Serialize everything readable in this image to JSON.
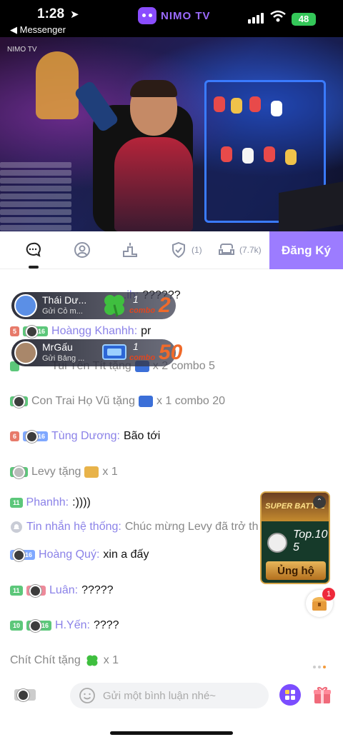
{
  "status": {
    "time": "1:28",
    "back": "◀ Messenger",
    "battery": "48"
  },
  "brand": {
    "name": "NIMO TV"
  },
  "video": {
    "watermark": "NIMO TV"
  },
  "tabs": {
    "fans_count": "(1)",
    "viewers_count": "(7.7k)",
    "subscribe": "Đăng Ký"
  },
  "banners": [
    {
      "name": "Thái Dư...",
      "sub": "Gửi Cỏ m...",
      "one": "1",
      "combo": "combo",
      "count": "2"
    },
    {
      "name": "MrGấu",
      "sub": "Gửi Bảng ...",
      "one": "1",
      "combo": "combo",
      "count": "50"
    }
  ],
  "messages": {
    "m0": {
      "name": "...ih:",
      "text": "??????"
    },
    "m1": {
      "level": "5",
      "fan": "16",
      "name": "Hoàngg Khanhh:",
      "text": "pr"
    },
    "m2": {
      "name": "Tui Tên Tít tặng",
      "text": "x 2 combo 5"
    },
    "m3": {
      "name": "Con Trai Họ Vũ tặng",
      "text": "x 1 combo 20"
    },
    "m4": {
      "level": "6",
      "fan": "16",
      "name": "Tùng Dương:",
      "text": "Bão tới"
    },
    "m5": {
      "name": "Levy tặng",
      "text": "x 1"
    },
    "m6": {
      "level": "11",
      "name": "Phanhh:",
      "text": ":))))"
    },
    "m7": {
      "label": "Tin nhắn hệ thống:",
      "text": "Chúc mừng Levy đã trở th"
    },
    "m8": {
      "fan": "16",
      "name": "Hoàng Quý:",
      "text": "xin a đấy"
    },
    "m9": {
      "level": "11",
      "name": "Luân:",
      "text": "?????"
    },
    "m10": {
      "level": "10",
      "fan": "16",
      "name": "H.Yến:",
      "text": "????"
    },
    "m11": {
      "name": "Chít Chít tặng",
      "text": "x 1"
    }
  },
  "battle": {
    "title": "SUPER BATTLE",
    "top": "Top.10",
    "rank": "5",
    "button": "Ủng hộ"
  },
  "chest": {
    "badge": "1"
  },
  "composer": {
    "placeholder": "Gửi một bình luận nhé~"
  },
  "colors": {
    "accent": "#9c7cff",
    "name": "#8b82e8",
    "brand": "#8a4dff"
  }
}
